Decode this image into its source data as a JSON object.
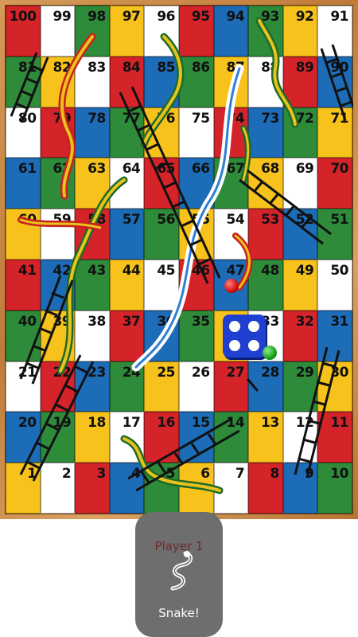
{
  "board": {
    "rows": [
      [
        100,
        99,
        98,
        97,
        96,
        95,
        94,
        93,
        92,
        91
      ],
      [
        81,
        82,
        83,
        84,
        85,
        86,
        87,
        88,
        89,
        90
      ],
      [
        80,
        79,
        78,
        77,
        76,
        75,
        74,
        73,
        72,
        71
      ],
      [
        61,
        62,
        63,
        64,
        65,
        66,
        67,
        68,
        69,
        70
      ],
      [
        60,
        59,
        58,
        57,
        56,
        55,
        54,
        53,
        52,
        51
      ],
      [
        41,
        42,
        43,
        44,
        45,
        46,
        47,
        48,
        49,
        50
      ],
      [
        40,
        39,
        38,
        37,
        36,
        35,
        34,
        33,
        32,
        31
      ],
      [
        21,
        22,
        23,
        24,
        25,
        26,
        27,
        28,
        29,
        30
      ],
      [
        20,
        19,
        18,
        17,
        16,
        15,
        14,
        13,
        12,
        11
      ],
      [
        1,
        2,
        3,
        4,
        5,
        6,
        7,
        8,
        9,
        10
      ]
    ],
    "colors": [
      [
        "red",
        "white",
        "green",
        "yellow",
        "white",
        "red",
        "blue",
        "green",
        "yellow",
        "white"
      ],
      [
        "green",
        "yellow",
        "white",
        "red",
        "blue",
        "green",
        "yellow",
        "white",
        "red",
        "blue"
      ],
      [
        "white",
        "red",
        "blue",
        "green",
        "yellow",
        "white",
        "red",
        "blue",
        "green",
        "yellow"
      ],
      [
        "blue",
        "green",
        "yellow",
        "white",
        "red",
        "blue",
        "green",
        "yellow",
        "white",
        "red"
      ],
      [
        "yellow",
        "white",
        "red",
        "blue",
        "green",
        "yellow",
        "white",
        "red",
        "blue",
        "green"
      ],
      [
        "red",
        "blue",
        "green",
        "yellow",
        "white",
        "red",
        "blue",
        "green",
        "yellow",
        "white"
      ],
      [
        "green",
        "yellow",
        "white",
        "red",
        "blue",
        "green",
        "yellow",
        "white",
        "red",
        "blue"
      ],
      [
        "white",
        "red",
        "blue",
        "green",
        "yellow",
        "white",
        "red",
        "blue",
        "green",
        "yellow"
      ],
      [
        "blue",
        "green",
        "yellow",
        "white",
        "red",
        "blue",
        "green",
        "yellow",
        "white",
        "red"
      ],
      [
        "yellow",
        "white",
        "red",
        "blue",
        "green",
        "yellow",
        "white",
        "red",
        "blue",
        "green"
      ]
    ]
  },
  "palette": {
    "red": "#d5232a",
    "blue": "#1c6cb8",
    "green": "#2e8b3a",
    "yellow": "#f6c21b",
    "white": "#ffffff",
    "frame": "#c07b3a"
  },
  "dice": {
    "value": 4,
    "icon": "dice-icon"
  },
  "tokens": [
    {
      "player": "red",
      "icon": "red-token"
    },
    {
      "player": "green",
      "icon": "green-token"
    }
  ],
  "toast": {
    "player_label": "Player 1",
    "message": "Snake!",
    "icon": "snake-icon"
  }
}
